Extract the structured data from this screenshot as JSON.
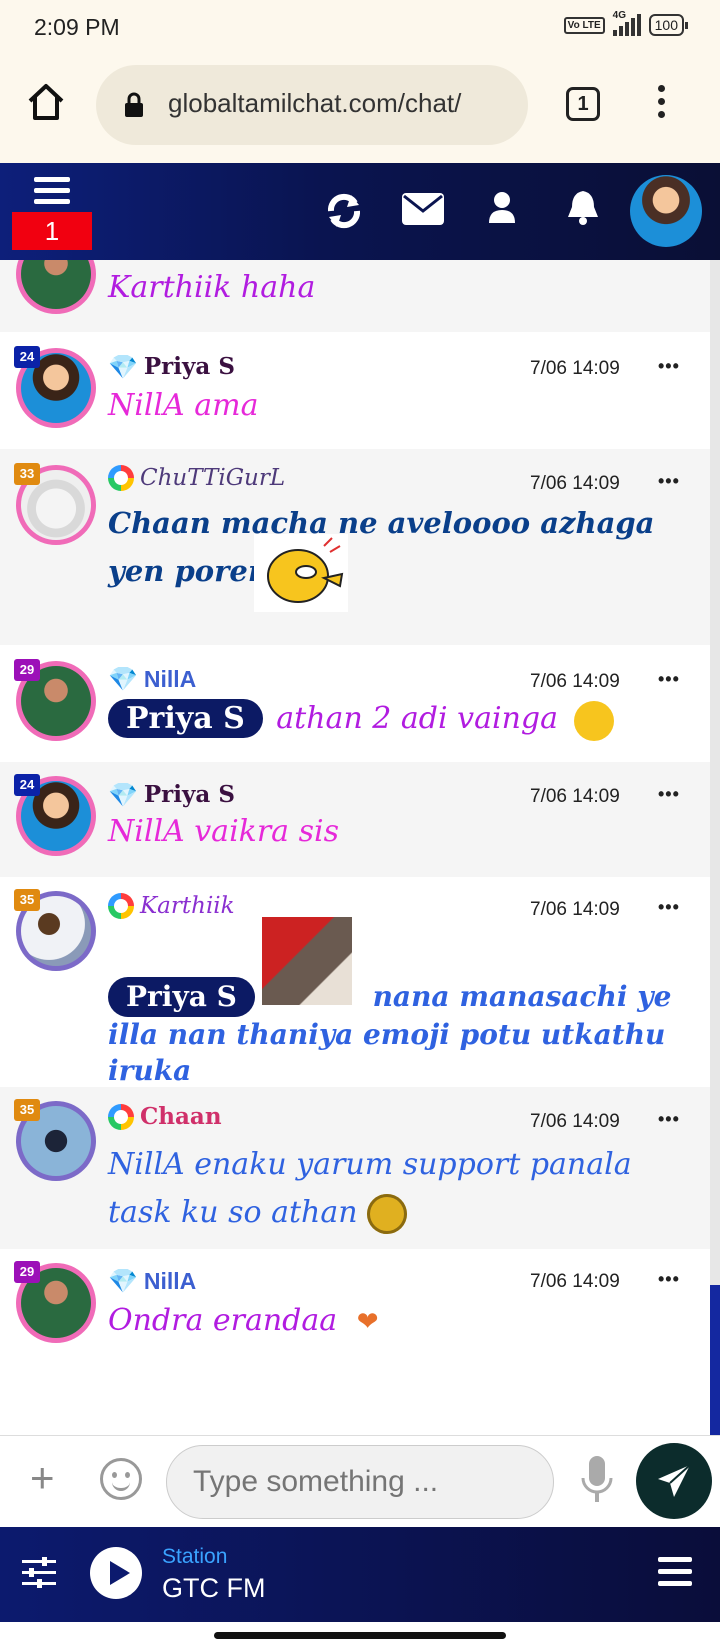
{
  "status": {
    "time": "2:09 PM",
    "network": "4G",
    "volte": "Vo LTE",
    "battery": "100"
  },
  "browser": {
    "url": "globaltamilchat.com/chat/",
    "tab_count": "1"
  },
  "header": {
    "notification_count": "1"
  },
  "messages": [
    {
      "user": "",
      "level": "",
      "badge": "",
      "time": "",
      "text": "Karthiik haha",
      "mention": "",
      "color": "#b11ce0",
      "avatar_ring": "#f06bb8"
    },
    {
      "user": "Priya S",
      "level": "24",
      "badge": "diamond",
      "time": "7/06 14:09",
      "text": "NillA ama",
      "mention": "",
      "color": "#e629d9",
      "name_color": "#3a1040",
      "avatar_ring": "#f06bb8",
      "level_color": "#0b22a8"
    },
    {
      "user": "ChuTTiGurL",
      "level": "33",
      "badge": "ring",
      "time": "7/06 14:09",
      "text": "Chaan macha ne aveloooo azhaga yen porenthe",
      "mention": "",
      "color": "#0a3f8a",
      "name_color": "#4e3a7a",
      "avatar_ring": "#f06bb8",
      "level_color": "#e08a10"
    },
    {
      "user": "NillA",
      "level": "29",
      "badge": "diamond",
      "time": "7/06 14:09",
      "text": "athan 2 adi vainga",
      "mention": "Priya S",
      "color": "#b11ce0",
      "name_color": "#3c5fd0",
      "avatar_ring": "#f06bb8",
      "level_color": "#9c10b8"
    },
    {
      "user": "Priya S",
      "level": "24",
      "badge": "diamond",
      "time": "7/06 14:09",
      "text": "NillA vaikra sis",
      "mention": "",
      "color": "#e629d9",
      "name_color": "#3a1040",
      "avatar_ring": "#f06bb8",
      "level_color": "#0b22a8"
    },
    {
      "user": "Karthiik",
      "level": "35",
      "badge": "ring",
      "time": "7/06 14:09",
      "text": "nana manasachi ye illa nan thaniya emoji potu utkathu iruka",
      "mention": "Priya S",
      "color": "#2f62e0",
      "name_color": "#8a2fd0",
      "avatar_ring": "#7c6ac8",
      "level_color": "#e08a10"
    },
    {
      "user": "Chaan",
      "level": "35",
      "badge": "ring",
      "time": "7/06 14:09",
      "text": "NillA enaku yarum support panala task ku so athan",
      "mention": "",
      "color": "#2f62e0",
      "name_color": "#d0306a",
      "avatar_ring": "#7c6ac8",
      "level_color": "#e08a10"
    },
    {
      "user": "NillA",
      "level": "29",
      "badge": "diamond",
      "time": "7/06 14:09",
      "text": "Ondra erandaa",
      "mention": "",
      "color": "#b11ce0",
      "name_color": "#3c5fd0",
      "avatar_ring": "#f06bb8",
      "level_color": "#9c10b8"
    }
  ],
  "input": {
    "placeholder": "Type something ..."
  },
  "player": {
    "label": "Station",
    "station": "GTC FM"
  },
  "icons": {
    "refresh": "refresh-icon",
    "mail": "mail-icon",
    "profile": "user-icon",
    "bell": "bell-icon",
    "send": "send-icon"
  }
}
